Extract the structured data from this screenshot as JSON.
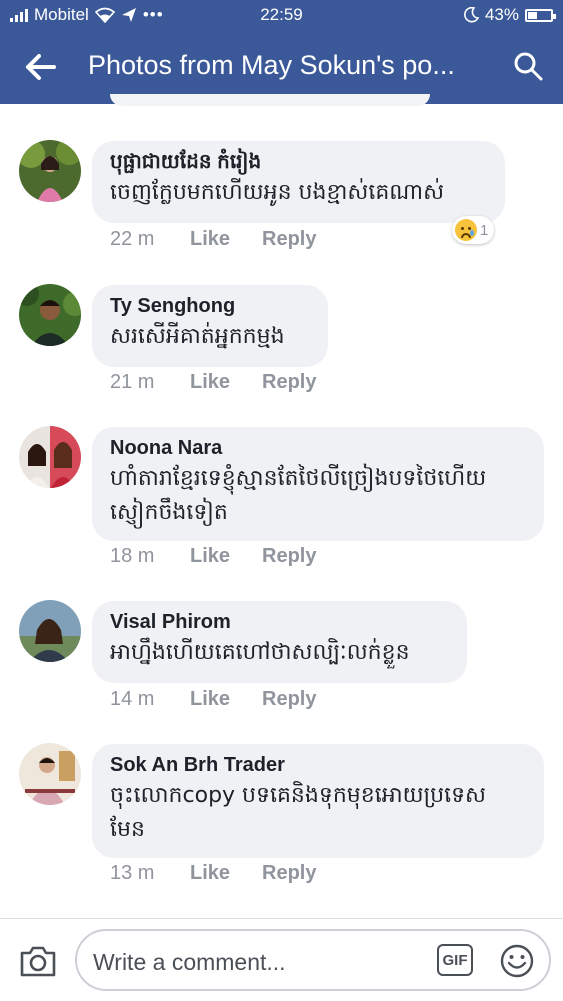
{
  "status_bar": {
    "carrier": "Mobitel",
    "time": "22:59",
    "battery": "43%",
    "battery_level": 0.43
  },
  "header": {
    "title": "Photos from May Sokun's po..."
  },
  "comments": [
    {
      "author": "បុផ្ផាជាយដែន កំរៀង",
      "text": "ចេញក្លែបមកហើយអូន បងខ្មាស់គេណាស់",
      "time": "22 m",
      "reaction_count": "1"
    },
    {
      "author": "Ty Senghong",
      "text": "សរសើអីគាត់អ្នកកម្មង",
      "time": "21 m"
    },
    {
      "author": "Noona Nara",
      "text": "ហាំតារាខ្មែរទេខ្ញុំស្មានតែថៃលីច្រៀងបទថៃហើយ ស្ញៀកចឹងទៀត",
      "time": "18 m"
    },
    {
      "author": "Visal Phirom",
      "text": "អាហ្នឹងហើយគេហៅថាសល្បិៈលក់ខ្លួន",
      "time": "14 m"
    },
    {
      "author": "Sok An Brh Trader",
      "text": "ចុះលោកcopy បទគេនិងទុកមុខអោយប្រទេស មែន",
      "time": "13 m"
    }
  ],
  "actions": {
    "like": "Like",
    "reply": "Reply"
  },
  "composer": {
    "placeholder": "Write a comment...",
    "gif": "GIF"
  }
}
